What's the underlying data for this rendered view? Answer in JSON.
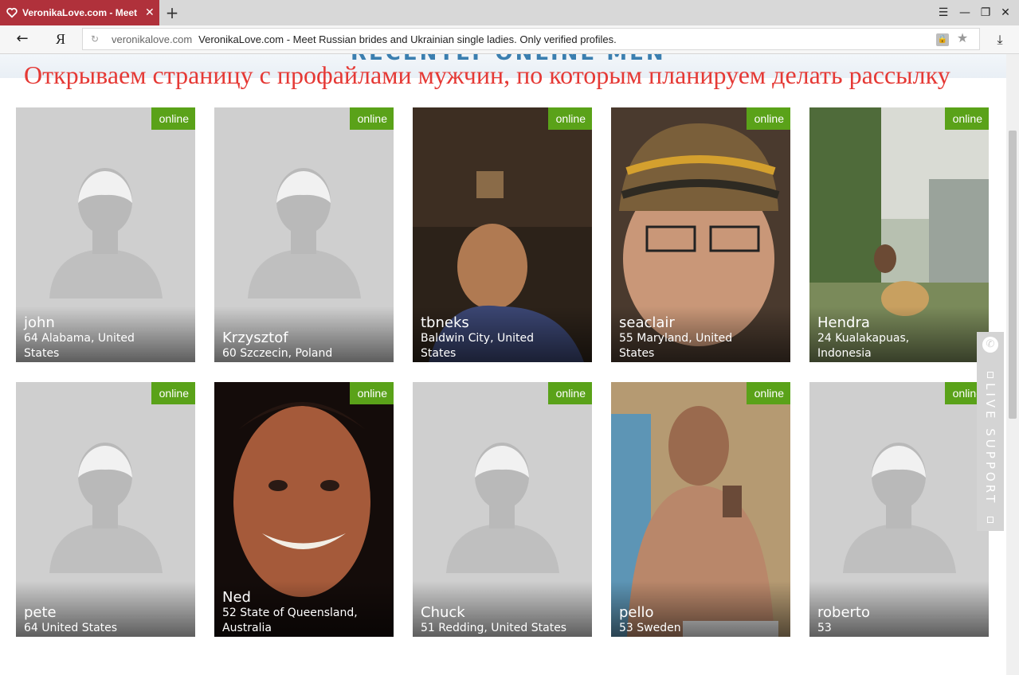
{
  "browser": {
    "tab_title": "VeronikaLove.com - Meet",
    "domain": "veronikalove.com",
    "page_title": "VeronikaLove.com - Meet Russian brides and Ukrainian single ladies. Only verified profiles.",
    "yandex_label": "Я",
    "new_tab": "+",
    "close": "✕"
  },
  "page": {
    "heading_partial": "RECENTLY ONLINE MEN",
    "overlay_caption": "Открываем страницу с профайлами мужчин, по которым планируем делать рассылку"
  },
  "profiles": [
    {
      "name": "john",
      "loc1": "64 Alabama, United",
      "loc2": "States",
      "badge": "online",
      "photo": "placeholder"
    },
    {
      "name": "Krzysztof",
      "loc1": "60 Szczecin, Poland",
      "loc2": "",
      "badge": "online",
      "photo": "placeholder"
    },
    {
      "name": "tbneks",
      "loc1": "Baldwin City, United",
      "loc2": "States",
      "badge": "online",
      "photo": "photo-dark"
    },
    {
      "name": "seaclair",
      "loc1": "55 Maryland, United",
      "loc2": "States",
      "badge": "online",
      "photo": "photo-hat"
    },
    {
      "name": "Hendra",
      "loc1": "24 Kualakapuas,",
      "loc2": "Indonesia",
      "badge": "online",
      "photo": "photo-outdoor"
    },
    {
      "name": "pete",
      "loc1": "64 United States",
      "loc2": "",
      "badge": "online",
      "photo": "placeholder"
    },
    {
      "name": "Ned",
      "loc1": "52 State of Queensland,",
      "loc2": "Australia",
      "badge": "online",
      "photo": "photo-smile"
    },
    {
      "name": "Chuck",
      "loc1": "51 Redding, United States",
      "loc2": "",
      "badge": "online",
      "photo": "placeholder"
    },
    {
      "name": "pello",
      "loc1": "53 Sweden",
      "loc2": "",
      "badge": "online",
      "photo": "photo-blurry"
    },
    {
      "name": "roberto",
      "loc1": "53",
      "loc2": "",
      "badge": "online",
      "photo": "placeholder"
    }
  ],
  "live_support": {
    "label": "LIVE SUPPORT"
  },
  "colors": {
    "tab_active": "#b0313b",
    "online_badge": "#5aa219",
    "overlay_text": "#e53935"
  }
}
